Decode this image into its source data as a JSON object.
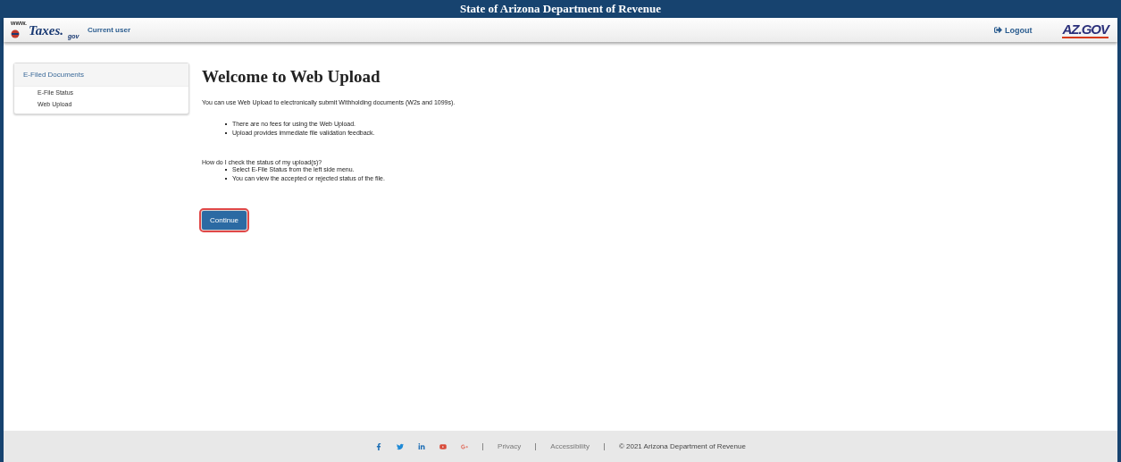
{
  "window": {
    "title": "State of Arizona Department of Revenue"
  },
  "header": {
    "logo": {
      "prefix": "www.",
      "name": "Taxes.",
      "suffix": "gov"
    },
    "user_label": "Current user",
    "logout": "Logout",
    "state_logo": "AZ.GOV"
  },
  "sidebar": {
    "heading": "E-Filed Documents",
    "items": [
      {
        "label": "E-File Status",
        "selected": false
      },
      {
        "label": "Web Upload",
        "selected": false
      }
    ]
  },
  "main": {
    "title": "Welcome to Web Upload",
    "intro": "You can use Web Upload to electronically submit Withholding documents (W2s and 1099s).",
    "bullets": [
      "There are no fees for using the Web Upload.",
      "Upload provides immediate file validation feedback."
    ],
    "question": "How do I check the status of my upload(s)?",
    "answers": [
      "Select E-File Status from the left side menu.",
      "You can view the accepted or rejected status of the file."
    ],
    "button": {
      "label": "Continue",
      "focused": true
    }
  },
  "footer": {
    "social": [
      {
        "kind": "facebook"
      },
      {
        "kind": "twitter"
      },
      {
        "kind": "linkedin"
      },
      {
        "kind": "youtube"
      },
      {
        "kind": "googleplus"
      }
    ],
    "links": [
      "Privacy",
      "Accessibility"
    ],
    "copyright": "© 2021 Arizona Department of Revenue"
  }
}
